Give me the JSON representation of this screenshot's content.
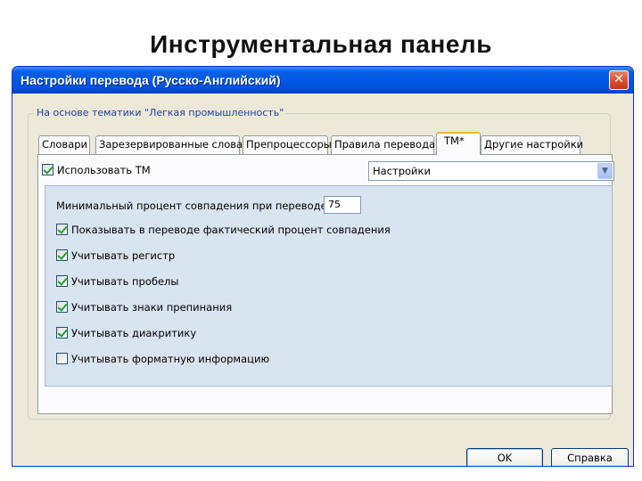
{
  "slide": {
    "title": "Инструментальная панель"
  },
  "window": {
    "title": "Настройки перевода (Русско-Английский)",
    "close_glyph": "✕"
  },
  "group": {
    "label": "На основе тематики \"Легкая промышленность\""
  },
  "tabs": [
    {
      "label": "Словари",
      "active": false
    },
    {
      "label": "Зарезервированные слова",
      "active": false
    },
    {
      "label": "Препроцессоры",
      "active": false
    },
    {
      "label": "Правила перевода",
      "active": false
    },
    {
      "label": "ТМ*",
      "active": true
    },
    {
      "label": "Другие настройки",
      "active": false
    }
  ],
  "tm_panel": {
    "use_tm": {
      "label": "Использовать ТМ",
      "checked": true
    },
    "settings_select": {
      "value": "Настройки",
      "arrow_icon": "chevron-down-icon"
    },
    "min_match": {
      "label": "Минимальный процент совпадения при переводе",
      "value": "75"
    },
    "options": [
      {
        "label": "Показывать в переводе фактический процент совпадения",
        "checked": true
      },
      {
        "label": "Учитывать регистр",
        "checked": true
      },
      {
        "label": "Учитывать пробелы",
        "checked": true
      },
      {
        "label": "Учитывать знаки препинания",
        "checked": true
      },
      {
        "label": "Учитывать диакритику",
        "checked": true
      },
      {
        "label": "Учитывать форматную информацию",
        "checked": false
      }
    ]
  },
  "buttons": {
    "ok": "OK",
    "help": "Справка"
  },
  "colors": {
    "titlebar": "#0058e6",
    "panel_bg": "#d9e4f1",
    "window_bg": "#ece9d8"
  }
}
